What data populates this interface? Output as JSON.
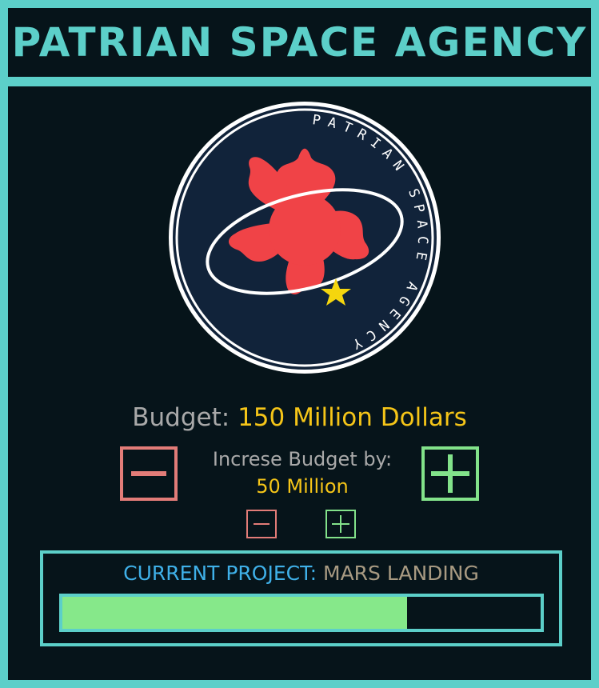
{
  "header": {
    "title": "PATRIAN SPACE AGENCY"
  },
  "emblem": {
    "ring_text": "PATRIAN SPACE AGENCY"
  },
  "budget": {
    "label": "Budget:",
    "value": "150 Million Dollars"
  },
  "increase": {
    "label": "Increse Budget by:",
    "amount": "50 Million"
  },
  "buttons": {
    "large_minus": "decrease-budget",
    "large_plus": "increase-budget",
    "small_minus": "decrease-step",
    "small_plus": "increase-step"
  },
  "project": {
    "label": "CURRENT PROJECT:",
    "name": "MARS LANDING",
    "progress": 0.72
  },
  "colors": {
    "accent": "#5ccfc9",
    "background": "#06141a",
    "budget_value": "#f5c518",
    "minus": "#e27c78",
    "plus": "#82e28a",
    "progress_fill": "#86e88a",
    "emblem_bg": "#11233a",
    "flower": "#f04347",
    "star": "#f5d60e"
  }
}
